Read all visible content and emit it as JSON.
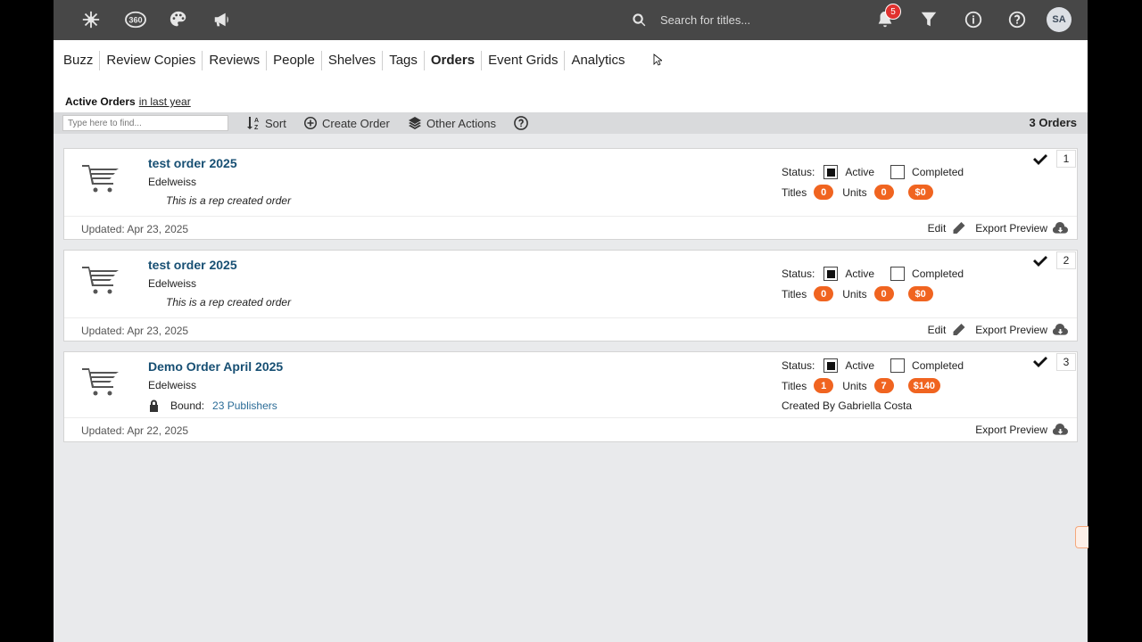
{
  "topbar": {
    "icons": [
      "snowflake-icon",
      "360-icon",
      "palette-icon",
      "megaphone-icon"
    ],
    "icon_360_label": "360",
    "search_placeholder": "Search for titles...",
    "notifications_count": "5",
    "avatar_initials": "SA"
  },
  "nav": {
    "items": [
      "Buzz",
      "Review Copies",
      "Reviews",
      "People",
      "Shelves",
      "Tags",
      "Orders",
      "Event Grids",
      "Analytics"
    ],
    "active": "Orders"
  },
  "header": {
    "title": "Active Orders",
    "range_link": "in last year"
  },
  "toolbar": {
    "find_placeholder": "Type here to find...",
    "sort_label": "Sort",
    "create_label": "Create Order",
    "other_label": "Other Actions",
    "orders_count": "3 Orders"
  },
  "orders": [
    {
      "title": "test order 2025",
      "org": "Edelweiss",
      "description": "This is a rep created order",
      "status_label": "Status:",
      "active_label": "Active",
      "completed_label": "Completed",
      "active_checked": true,
      "completed_checked": false,
      "titles_label": "Titles",
      "titles": "0",
      "units_label": "Units",
      "units": "0",
      "amount": "$0",
      "updated": "Updated: Apr 23, 2025",
      "edit_label": "Edit",
      "export_label": "Export Preview",
      "number": "1"
    },
    {
      "title": "test order 2025",
      "org": "Edelweiss",
      "description": "This is a rep created order",
      "status_label": "Status:",
      "active_label": "Active",
      "completed_label": "Completed",
      "active_checked": true,
      "completed_checked": false,
      "titles_label": "Titles",
      "titles": "0",
      "units_label": "Units",
      "units": "0",
      "amount": "$0",
      "updated": "Updated: Apr 23, 2025",
      "edit_label": "Edit",
      "export_label": "Export Preview",
      "number": "2"
    },
    {
      "title": "Demo Order April 2025",
      "org": "Edelweiss",
      "bound_label": "Bound:",
      "bound_link": "23 Publishers",
      "status_label": "Status:",
      "active_label": "Active",
      "completed_label": "Completed",
      "active_checked": true,
      "completed_checked": false,
      "titles_label": "Titles",
      "titles": "1",
      "units_label": "Units",
      "units": "7",
      "amount": "$140",
      "created_by": "Created By Gabriella Costa",
      "updated": "Updated: Apr 22, 2025",
      "export_label": "Export Preview",
      "number": "3"
    }
  ],
  "colors": {
    "topbar_bg": "#474747",
    "accent_orange": "#f06420",
    "title_blue": "#174f73",
    "link_blue": "#2b6c97",
    "notif_red": "#e0312f"
  }
}
